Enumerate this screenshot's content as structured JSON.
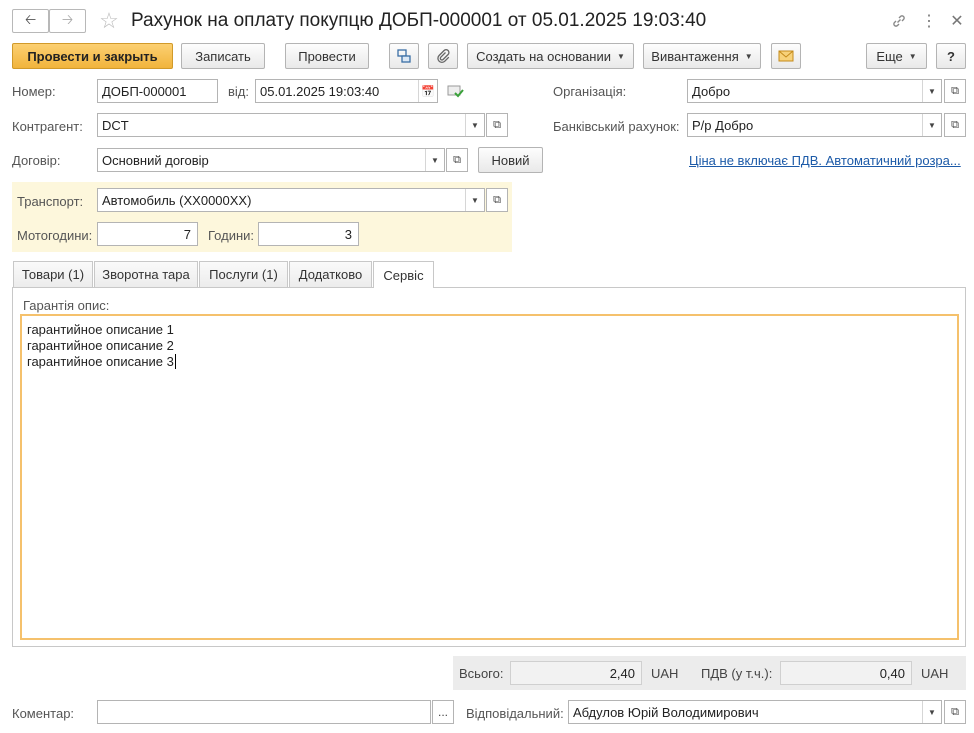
{
  "window": {
    "title": "Рахунок на оплату покупцю ДОБП-000001 от 05.01.2025 19:03:40"
  },
  "toolbar": {
    "post_close": "Провести и закрыть",
    "save": "Записать",
    "post": "Провести",
    "create_based": "Создать на основании",
    "unload": "Вивантаження",
    "more": "Еще",
    "help": "?"
  },
  "form": {
    "number_label": "Номер:",
    "number_value": "ДОБП-000001",
    "from_label": "від:",
    "date_value": "05.01.2025 19:03:40",
    "org_label": "Організація:",
    "org_value": "Добро",
    "contractor_label": "Контрагент:",
    "contractor_value": "DCT",
    "bank_label": "Банківський рахунок:",
    "bank_value": "Р/р Добро",
    "contract_label": "Договір:",
    "contract_value": "Основний договір",
    "new_button": "Новий",
    "vat_link": "Ціна не включає ПДВ. Автоматичний розра..."
  },
  "transport": {
    "label": "Транспорт:",
    "value": "Автомобиль (ХХ0000ХХ)",
    "moto_label": "Мотогодини:",
    "moto_value": "7",
    "hours_label": "Години:",
    "hours_value": "3"
  },
  "tabs": [
    {
      "label": "Товари (1)"
    },
    {
      "label": "Зворотна тара"
    },
    {
      "label": "Послуги (1)"
    },
    {
      "label": "Додатково"
    },
    {
      "label": "Сервіс"
    }
  ],
  "service": {
    "warranty_label": "Гарантія опис:",
    "lines": [
      "гарантийное описание 1",
      "гарантийное описание 2",
      "гарантийное описание 3"
    ]
  },
  "totals": {
    "total_label": "Всього:",
    "total_value": "2,40",
    "currency": "UAH",
    "vat_label": "ПДВ (у т.ч.):",
    "vat_value": "0,40",
    "vat_currency": "UAH"
  },
  "footer": {
    "comment_label": "Коментар:",
    "comment_value": "",
    "responsible_label": "Відповідальний:",
    "responsible_value": "Абдулов Юрій Володимирович"
  }
}
